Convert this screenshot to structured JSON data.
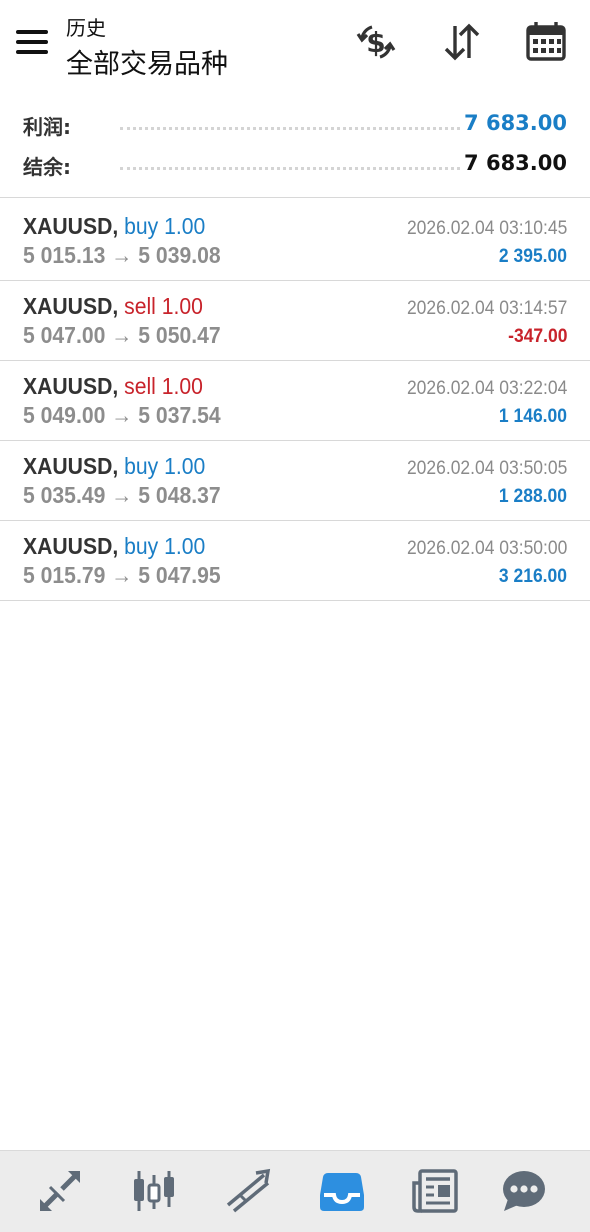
{
  "header": {
    "subtitle": "历史",
    "title": "全部交易品种"
  },
  "summary": {
    "profit_label": "利润:",
    "profit_value": "7 683.00",
    "balance_label": "结余:",
    "balance_value": "7 683.00"
  },
  "deals": [
    {
      "symbol": "XAUUSD,",
      "side": "buy 1.00",
      "prices": "5 015.13 → 5 039.08",
      "time": "2026.02.04 03:10:45",
      "profit": "2 395.00"
    },
    {
      "symbol": "XAUUSD,",
      "side": "sell 1.00",
      "prices": "5 047.00 → 5 050.47",
      "time": "2026.02.04 03:14:57",
      "profit": "-347.00"
    },
    {
      "symbol": "XAUUSD,",
      "side": "sell 1.00",
      "prices": "5 049.00 → 5 037.54",
      "time": "2026.02.04 03:22:04",
      "profit": "1 146.00"
    },
    {
      "symbol": "XAUUSD,",
      "side": "buy 1.00",
      "prices": "5 035.49 → 5 048.37",
      "time": "2026.02.04 03:50:05",
      "profit": "1 288.00"
    },
    {
      "symbol": "XAUUSD,",
      "side": "buy 1.00",
      "prices": "5 015.79 → 5 047.95",
      "time": "2026.02.04 03:50:00",
      "profit": "3 216.00"
    }
  ],
  "toolbar_icons": [
    "currency-exchange-icon",
    "sort-icon",
    "calendar-icon"
  ],
  "bottom_nav": [
    "quotes-icon",
    "chart-icon",
    "trade-icon",
    "history-icon",
    "news-icon",
    "chat-icon"
  ],
  "colors": {
    "accent_blue": "#1a7ec6",
    "loss_red": "#c8232b",
    "active_nav": "#2d8fe0",
    "inactive_nav": "#5f6b78"
  }
}
